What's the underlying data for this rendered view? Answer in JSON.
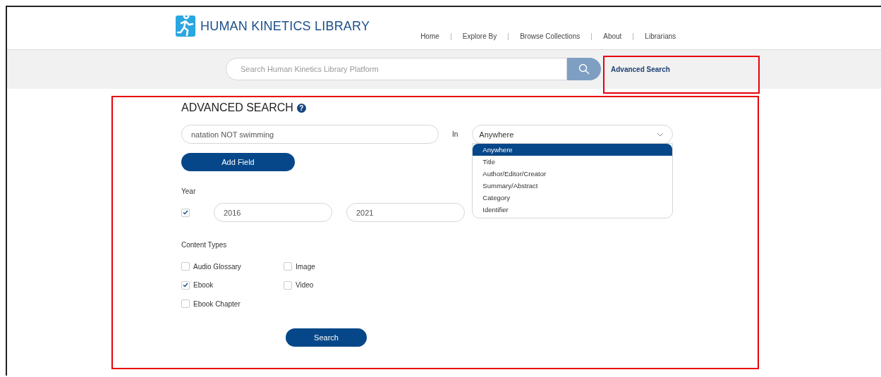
{
  "site": {
    "name": "HUMAN KINETICS LIBRARY"
  },
  "nav": [
    "Home",
    "Explore By",
    "Browse Collections",
    "About",
    "Librarians"
  ],
  "search_bar": {
    "placeholder": "Search Human Kinetics Library Platform",
    "advanced_link": "Advanced Search"
  },
  "form": {
    "title": "ADVANCED SEARCH",
    "help": "?",
    "query": {
      "value": "natation NOT swimming",
      "in_label": "In",
      "field": "Anywhere",
      "field_options": [
        {
          "label": "Anywhere",
          "selected": true
        },
        {
          "label": "Title",
          "selected": false
        },
        {
          "label": "Author/Editor/Creator",
          "selected": false
        },
        {
          "label": "Summary/Abstract",
          "selected": false
        },
        {
          "label": "Category",
          "selected": false
        },
        {
          "label": "Identifier",
          "selected": false
        }
      ]
    },
    "add_field": "Add Field",
    "year": {
      "label": "Year",
      "checked": true,
      "from": "2016",
      "to": "2021"
    },
    "content_types": {
      "label": "Content Types",
      "items": [
        {
          "label": "Audio Glossary",
          "checked": false
        },
        {
          "label": "Ebook",
          "checked": true
        },
        {
          "label": "Ebook Chapter",
          "checked": false
        },
        {
          "label": "Image",
          "checked": false
        },
        {
          "label": "Video",
          "checked": false
        }
      ]
    },
    "submit": "Search"
  }
}
